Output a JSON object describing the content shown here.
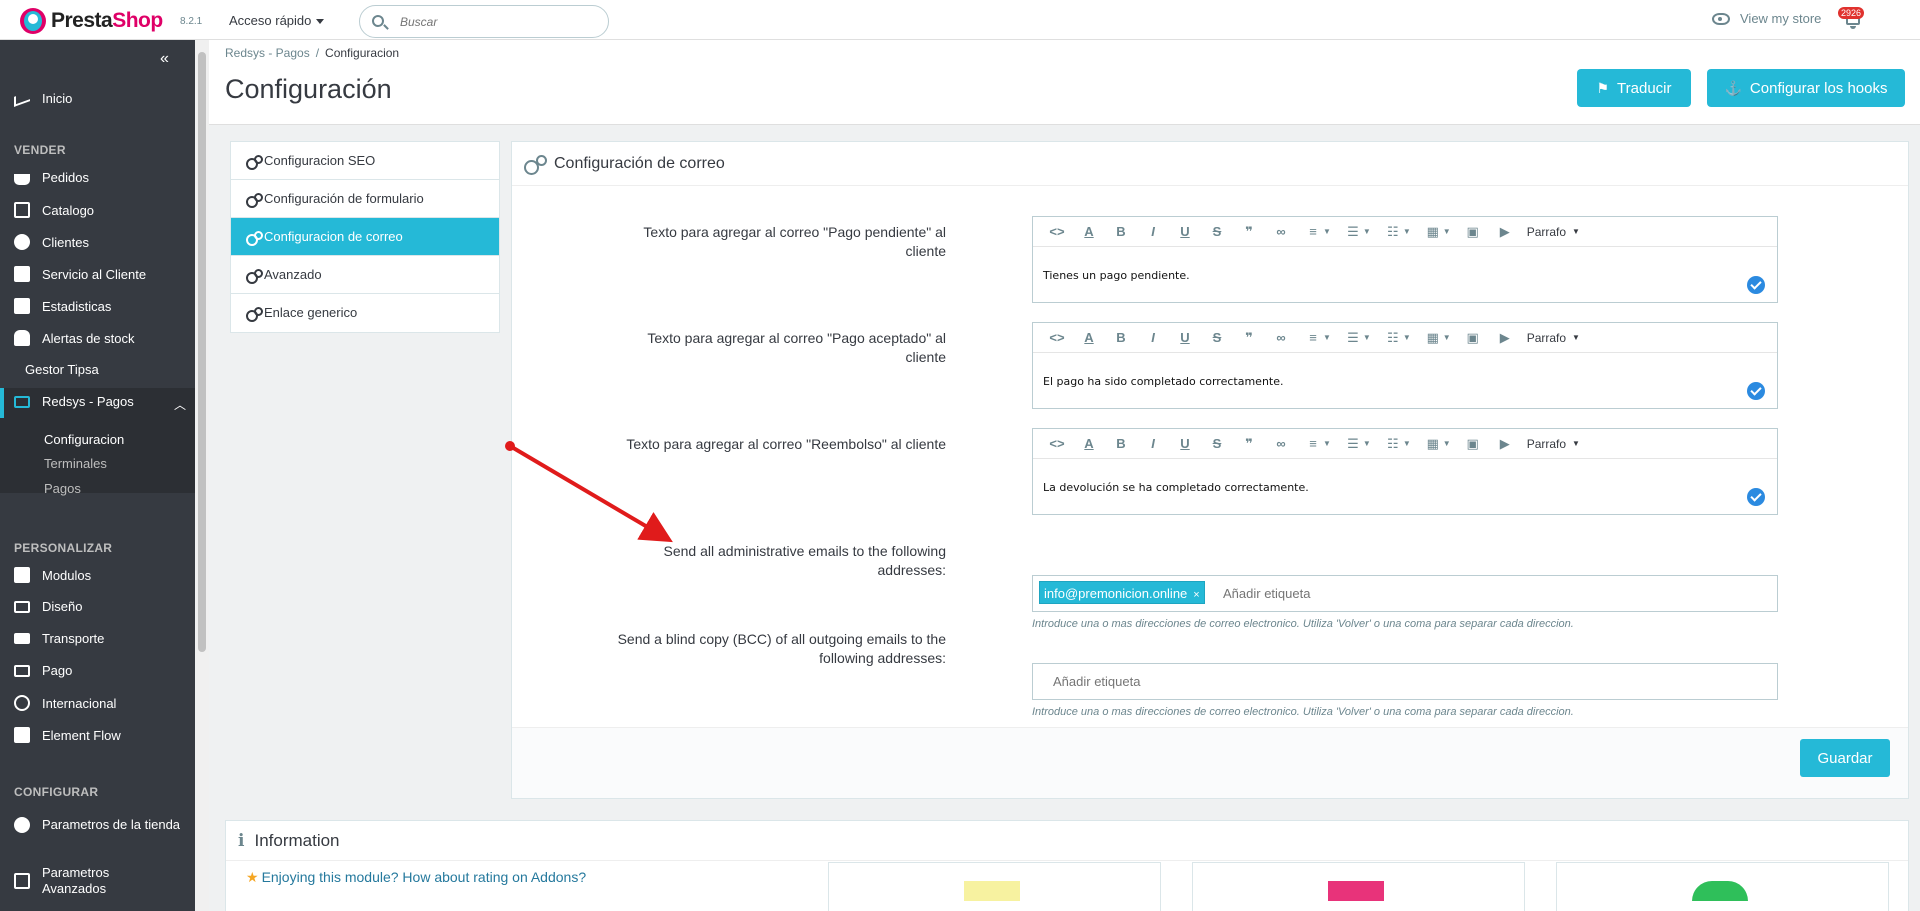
{
  "header": {
    "logo_prefix": "Presta",
    "logo_suffix": "Shop",
    "version": "8.2.1",
    "quick_access": "Acceso rápido",
    "search_placeholder": "Buscar",
    "view_store": "View my store",
    "notifications": "2926"
  },
  "sidebar": {
    "items": [
      {
        "label": "Inicio",
        "icon": "trending-up-icon"
      },
      {
        "label": "Pedidos",
        "icon": "basket-icon"
      },
      {
        "label": "Catalogo",
        "icon": "store-icon"
      },
      {
        "label": "Clientes",
        "icon": "account-icon"
      },
      {
        "label": "Servicio al Cliente",
        "icon": "chat-icon"
      },
      {
        "label": "Estadisticas",
        "icon": "bar-chart-icon"
      },
      {
        "label": "Alertas de stock",
        "icon": "bell-alert-icon"
      },
      {
        "label": "Gestor Tipsa",
        "icon": ""
      },
      {
        "label": "Redsys - Pagos",
        "icon": "credit-card-icon"
      },
      {
        "label": "Modulos",
        "icon": "puzzle-icon"
      },
      {
        "label": "Diseño",
        "icon": "desktop-icon"
      },
      {
        "label": "Transporte",
        "icon": "truck-icon"
      },
      {
        "label": "Pago",
        "icon": "payment-icon"
      },
      {
        "label": "Internacional",
        "icon": "globe-icon"
      },
      {
        "label": "Element Flow",
        "icon": "element-icon"
      },
      {
        "label": "Parametros de la tienda",
        "icon": "settings-icon"
      },
      {
        "label": "Parametros Avanzados",
        "icon": "advanced-icon"
      }
    ],
    "sections": [
      "VENDER",
      "PERSONALIZAR",
      "CONFIGURAR"
    ],
    "subitems": [
      "Configuracion",
      "Terminales",
      "Pagos"
    ]
  },
  "breadcrumb": {
    "parent": "Redsys - Pagos",
    "separator": "/",
    "current": "Configuracion"
  },
  "page_title": "Configuración",
  "buttons": {
    "translate": "Traducir",
    "hooks": "Configurar los hooks",
    "save": "Guardar"
  },
  "tabs": [
    "Configuracion SEO",
    "Configuración de formulario",
    "Configuracion de correo",
    "Avanzado",
    "Enlace generico"
  ],
  "panel": {
    "title": "Configuración de correo",
    "fields": [
      {
        "label": "Texto para agregar al correo \"Pago pendiente\" al cliente",
        "value": "Tienes un pago pendiente."
      },
      {
        "label": "Texto para agregar al correo \"Pago aceptado\" al cliente",
        "value": "El pago ha sido completado correctamente."
      },
      {
        "label": "Texto para agregar al correo \"Reembolso\" al cliente",
        "value": "La devolución se ha completado correctamente."
      }
    ],
    "editor_paragraph": "Parrafo",
    "admin_label": "Send all administrative emails to the following addresses:",
    "admin_tag": "info@premonicion.online",
    "tag_placeholder": "Añadir etiqueta",
    "bcc_label": "Send a blind copy (BCC) of all outgoing emails to the following addresses:",
    "help_text": "Introduce una o mas direcciones de correo electronico. Utiliza 'Volver' o una coma para separar cada direccion."
  },
  "info": {
    "title": "Information",
    "rate_text": "Enjoying this module? How about rating on Addons?"
  },
  "colors": {
    "accent": "#25b9d7",
    "sidebar": "#363a41",
    "arrow": "#e01b1b",
    "brand": "#df0067"
  }
}
